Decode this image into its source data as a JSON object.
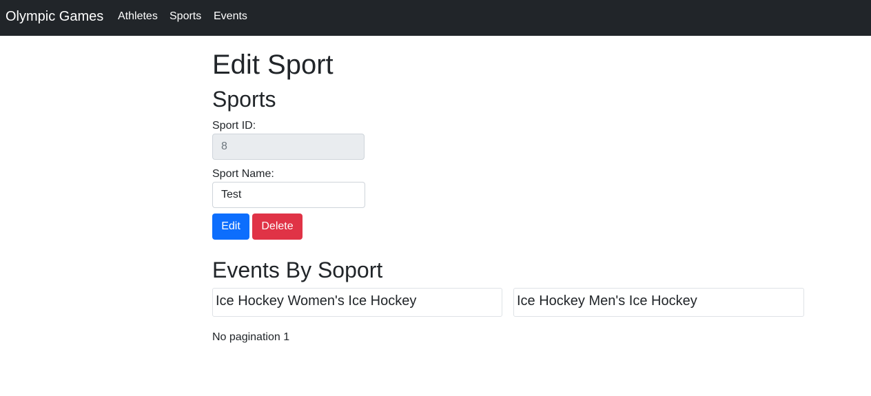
{
  "navbar": {
    "brand": "Olympic Games",
    "links": [
      "Athletes",
      "Sports",
      "Events"
    ]
  },
  "page": {
    "title": "Edit Sport",
    "form_title": "Sports",
    "sport_id": {
      "label": "Sport ID:",
      "value": "8"
    },
    "sport_name": {
      "label": "Sport Name:",
      "value": "Test"
    },
    "buttons": {
      "edit": "Edit",
      "delete": "Delete"
    },
    "events_title": "Events By Soport",
    "events": [
      "Ice Hockey Women's Ice Hockey",
      "Ice Hockey Men's Ice Hockey"
    ],
    "pagination": "No pagination 1"
  },
  "colors": {
    "navbar_bg": "#212529",
    "primary": "#0d6efd",
    "danger": "#e03346",
    "readonly_bg": "#e9ecef"
  }
}
